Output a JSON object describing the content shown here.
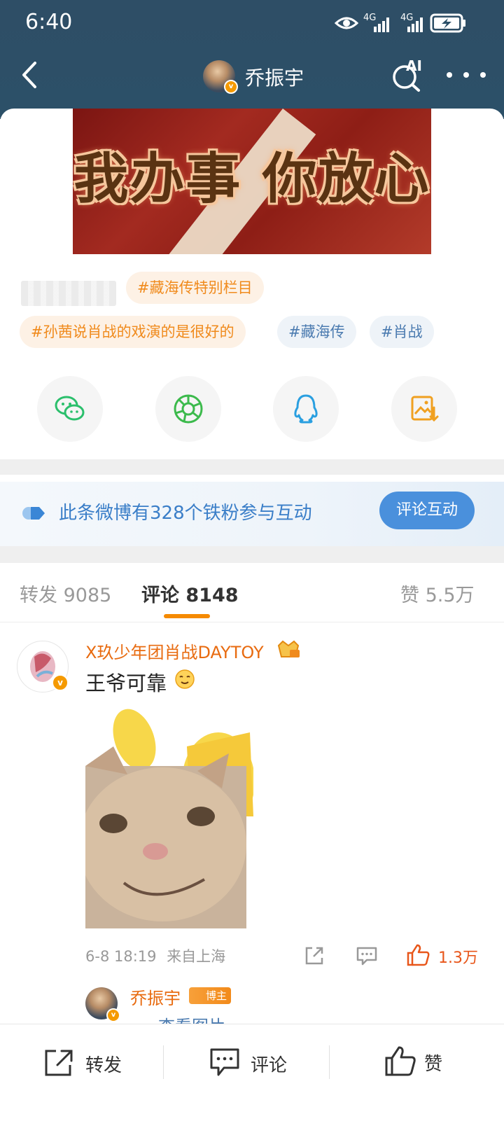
{
  "status_bar": {
    "time": "6:40",
    "net1": "4G",
    "net2": "4G"
  },
  "header": {
    "title": "乔振宇",
    "ai_label": "AI",
    "back_icon": "chevron-left-icon",
    "more_icon": "more-horizontal-icon",
    "verified_badge": "v"
  },
  "post": {
    "banner_text": "我办事 你放心",
    "tags": [
      "#藏海传特别栏目",
      "#孙茜说肖战的戏演的是很好的",
      "#藏海传",
      "#肖战"
    ],
    "share_icons": [
      "wechat-icon",
      "moments-icon",
      "qq-icon",
      "save-image-icon"
    ]
  },
  "fans_bar": {
    "text": "此条微博有328个铁粉参与互动",
    "button": "评论互动"
  },
  "tabs": {
    "repost": "转发 9085",
    "comment": "评论 8148",
    "like": "赞 5.5万"
  },
  "comment": {
    "user": "X玖少年团肖战DAYTOY",
    "text": "王爷可靠",
    "time": "6-8 18:19",
    "location": "来自上海",
    "likes": "1.3万",
    "reply": {
      "user": "乔振宇",
      "badge": "博主",
      "text": "查看图片"
    }
  },
  "bottom_bar": {
    "repost": "转发",
    "comment": "评论",
    "like": "赞"
  },
  "colors": {
    "header_bg": "#2c5068",
    "accent_orange": "#f58a00",
    "link_blue": "#3a7ec8",
    "like_red": "#e8561a"
  }
}
